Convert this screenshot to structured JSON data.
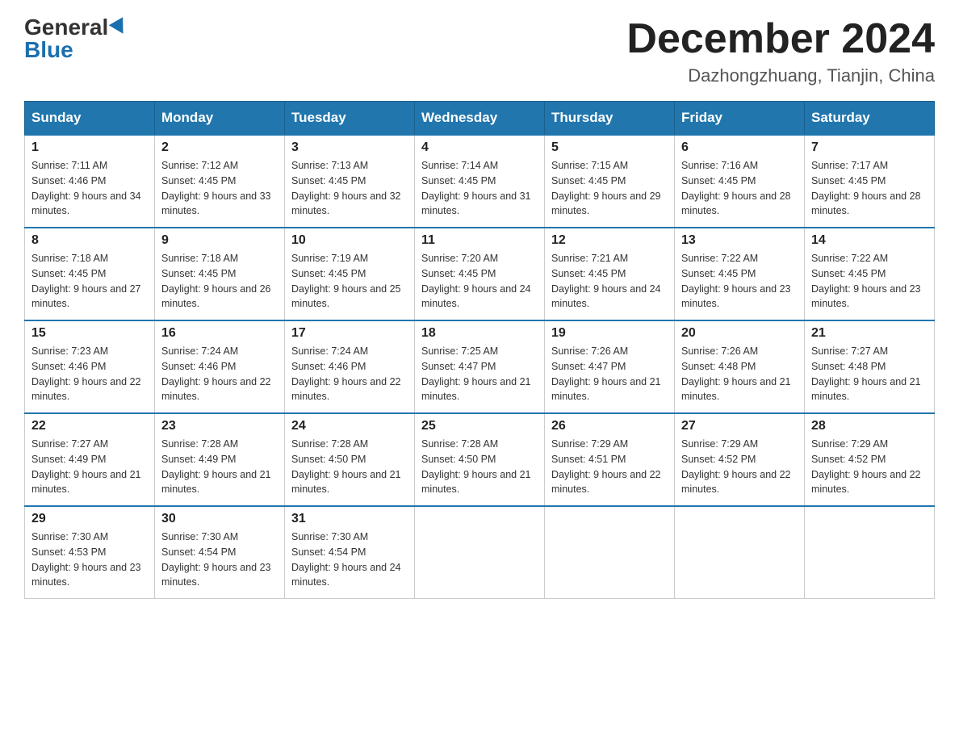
{
  "header": {
    "logo_general": "General",
    "logo_blue": "Blue",
    "month_title": "December 2024",
    "location": "Dazhongzhuang, Tianjin, China"
  },
  "weekdays": [
    "Sunday",
    "Monday",
    "Tuesday",
    "Wednesday",
    "Thursday",
    "Friday",
    "Saturday"
  ],
  "weeks": [
    [
      {
        "day": "1",
        "sunrise": "7:11 AM",
        "sunset": "4:46 PM",
        "daylight": "9 hours and 34 minutes."
      },
      {
        "day": "2",
        "sunrise": "7:12 AM",
        "sunset": "4:45 PM",
        "daylight": "9 hours and 33 minutes."
      },
      {
        "day": "3",
        "sunrise": "7:13 AM",
        "sunset": "4:45 PM",
        "daylight": "9 hours and 32 minutes."
      },
      {
        "day": "4",
        "sunrise": "7:14 AM",
        "sunset": "4:45 PM",
        "daylight": "9 hours and 31 minutes."
      },
      {
        "day": "5",
        "sunrise": "7:15 AM",
        "sunset": "4:45 PM",
        "daylight": "9 hours and 29 minutes."
      },
      {
        "day": "6",
        "sunrise": "7:16 AM",
        "sunset": "4:45 PM",
        "daylight": "9 hours and 28 minutes."
      },
      {
        "day": "7",
        "sunrise": "7:17 AM",
        "sunset": "4:45 PM",
        "daylight": "9 hours and 28 minutes."
      }
    ],
    [
      {
        "day": "8",
        "sunrise": "7:18 AM",
        "sunset": "4:45 PM",
        "daylight": "9 hours and 27 minutes."
      },
      {
        "day": "9",
        "sunrise": "7:18 AM",
        "sunset": "4:45 PM",
        "daylight": "9 hours and 26 minutes."
      },
      {
        "day": "10",
        "sunrise": "7:19 AM",
        "sunset": "4:45 PM",
        "daylight": "9 hours and 25 minutes."
      },
      {
        "day": "11",
        "sunrise": "7:20 AM",
        "sunset": "4:45 PM",
        "daylight": "9 hours and 24 minutes."
      },
      {
        "day": "12",
        "sunrise": "7:21 AM",
        "sunset": "4:45 PM",
        "daylight": "9 hours and 24 minutes."
      },
      {
        "day": "13",
        "sunrise": "7:22 AM",
        "sunset": "4:45 PM",
        "daylight": "9 hours and 23 minutes."
      },
      {
        "day": "14",
        "sunrise": "7:22 AM",
        "sunset": "4:45 PM",
        "daylight": "9 hours and 23 minutes."
      }
    ],
    [
      {
        "day": "15",
        "sunrise": "7:23 AM",
        "sunset": "4:46 PM",
        "daylight": "9 hours and 22 minutes."
      },
      {
        "day": "16",
        "sunrise": "7:24 AM",
        "sunset": "4:46 PM",
        "daylight": "9 hours and 22 minutes."
      },
      {
        "day": "17",
        "sunrise": "7:24 AM",
        "sunset": "4:46 PM",
        "daylight": "9 hours and 22 minutes."
      },
      {
        "day": "18",
        "sunrise": "7:25 AM",
        "sunset": "4:47 PM",
        "daylight": "9 hours and 21 minutes."
      },
      {
        "day": "19",
        "sunrise": "7:26 AM",
        "sunset": "4:47 PM",
        "daylight": "9 hours and 21 minutes."
      },
      {
        "day": "20",
        "sunrise": "7:26 AM",
        "sunset": "4:48 PM",
        "daylight": "9 hours and 21 minutes."
      },
      {
        "day": "21",
        "sunrise": "7:27 AM",
        "sunset": "4:48 PM",
        "daylight": "9 hours and 21 minutes."
      }
    ],
    [
      {
        "day": "22",
        "sunrise": "7:27 AM",
        "sunset": "4:49 PM",
        "daylight": "9 hours and 21 minutes."
      },
      {
        "day": "23",
        "sunrise": "7:28 AM",
        "sunset": "4:49 PM",
        "daylight": "9 hours and 21 minutes."
      },
      {
        "day": "24",
        "sunrise": "7:28 AM",
        "sunset": "4:50 PM",
        "daylight": "9 hours and 21 minutes."
      },
      {
        "day": "25",
        "sunrise": "7:28 AM",
        "sunset": "4:50 PM",
        "daylight": "9 hours and 21 minutes."
      },
      {
        "day": "26",
        "sunrise": "7:29 AM",
        "sunset": "4:51 PM",
        "daylight": "9 hours and 22 minutes."
      },
      {
        "day": "27",
        "sunrise": "7:29 AM",
        "sunset": "4:52 PM",
        "daylight": "9 hours and 22 minutes."
      },
      {
        "day": "28",
        "sunrise": "7:29 AM",
        "sunset": "4:52 PM",
        "daylight": "9 hours and 22 minutes."
      }
    ],
    [
      {
        "day": "29",
        "sunrise": "7:30 AM",
        "sunset": "4:53 PM",
        "daylight": "9 hours and 23 minutes."
      },
      {
        "day": "30",
        "sunrise": "7:30 AM",
        "sunset": "4:54 PM",
        "daylight": "9 hours and 23 minutes."
      },
      {
        "day": "31",
        "sunrise": "7:30 AM",
        "sunset": "4:54 PM",
        "daylight": "9 hours and 24 minutes."
      },
      null,
      null,
      null,
      null
    ]
  ],
  "labels": {
    "sunrise_prefix": "Sunrise: ",
    "sunset_prefix": "Sunset: ",
    "daylight_prefix": "Daylight: "
  }
}
